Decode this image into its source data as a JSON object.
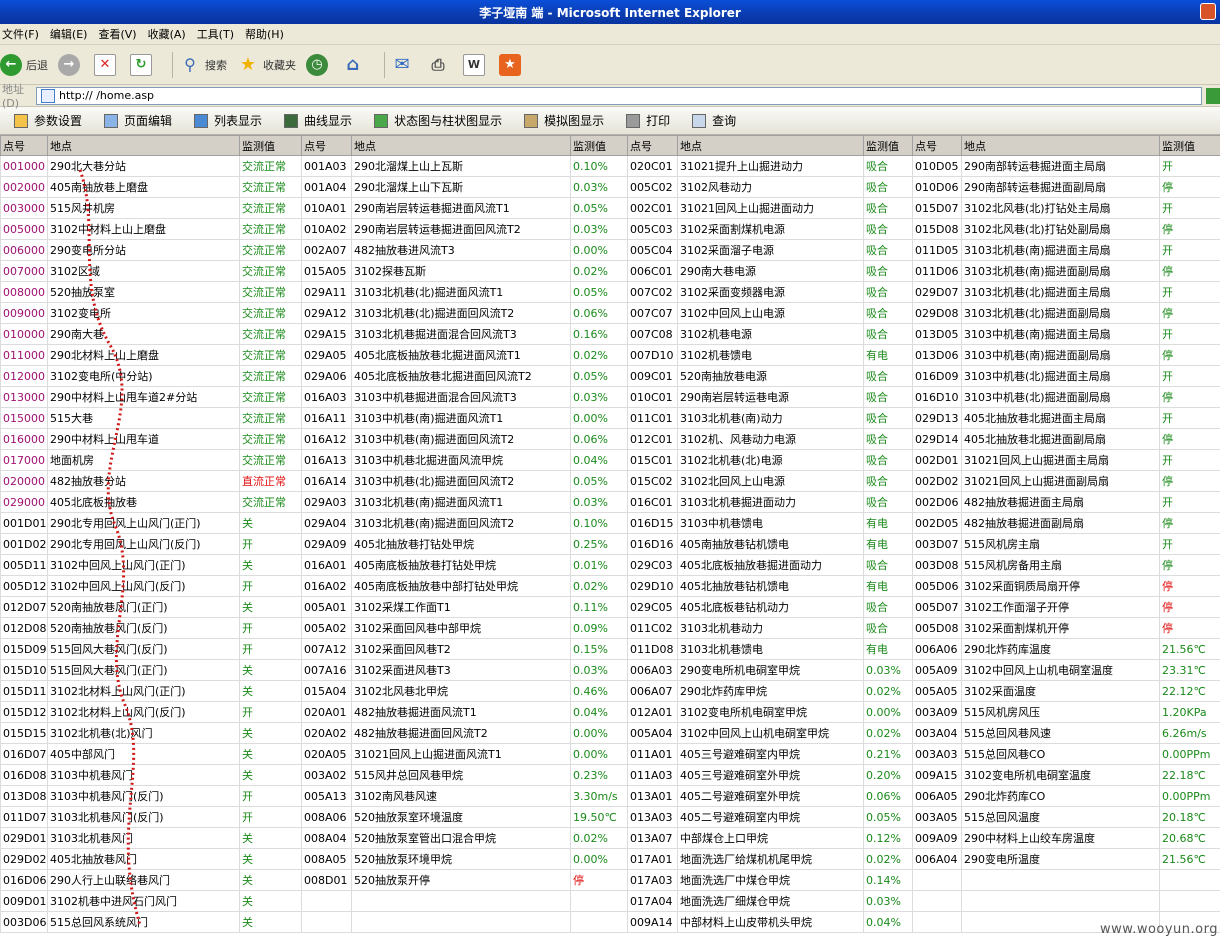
{
  "window": {
    "title": "李子垭南           端 - Microsoft Internet Explorer"
  },
  "menu": [
    "文件(F)",
    "编辑(E)",
    "查看(V)",
    "收藏(A)",
    "工具(T)",
    "帮助(H)"
  ],
  "toolbar": {
    "back": "后退",
    "search": "搜索",
    "favorites": "收藏夹"
  },
  "address": {
    "label": "地址(D)",
    "url": "http://                        /home.asp"
  },
  "appnav": [
    "参数设置",
    "页面编辑",
    "列表显示",
    "曲线显示",
    "状态图与柱状图显示",
    "模拟图显示",
    "打印",
    "查询"
  ],
  "headers": [
    "点号",
    "地点",
    "监测值",
    "点号",
    "地点",
    "监测值",
    "点号",
    "地点",
    "监测值",
    "点号",
    "地点",
    "监测值"
  ],
  "rows": [
    [
      "001000",
      "290北大巷分站",
      "交流正常",
      "001A03",
      "290北溜煤上山上瓦斯",
      "0.10%",
      "020C01",
      "31021提升上山掘进动力",
      "吸合",
      "010D05",
      "290南部转运巷掘进面主局扇",
      "开"
    ],
    [
      "002000",
      "405南抽放巷上磨盘",
      "交流正常",
      "001A04",
      "290北溜煤上山下瓦斯",
      "0.03%",
      "005C02",
      "3102风巷动力",
      "吸合",
      "010D06",
      "290南部转运巷掘进面副局扇",
      "停"
    ],
    [
      "003000",
      "515风井机房",
      "交流正常",
      "010A01",
      "290南岩层转运巷掘进面风流T1",
      "0.05%",
      "002C01",
      "31021回风上山掘进面动力",
      "吸合",
      "015D07",
      "3102北风巷(北)打钻处主局扇",
      "开"
    ],
    [
      "005000",
      "3102中材料上山上磨盘",
      "交流正常",
      "010A02",
      "290南岩层转运巷掘进面回风流T2",
      "0.03%",
      "005C03",
      "3102采面割煤机电源",
      "吸合",
      "015D08",
      "3102北风巷(北)打钻处副局扇",
      "停"
    ],
    [
      "006000",
      "290变电所分站",
      "交流正常",
      "002A07",
      "482抽放巷进风流T3",
      "0.00%",
      "005C04",
      "3102采面溜子电源",
      "吸合",
      "011D05",
      "3103北机巷(南)掘进面主局扇",
      "开"
    ],
    [
      "007000",
      "3102区域",
      "交流正常",
      "015A05",
      "3102探巷瓦斯",
      "0.02%",
      "006C01",
      "290南大巷电源",
      "吸合",
      "011D06",
      "3103北机巷(南)掘进面副局扇",
      "停"
    ],
    [
      "008000",
      "520抽放泵室",
      "交流正常",
      "029A11",
      "3103北机巷(北)掘进面风流T1",
      "0.05%",
      "007C02",
      "3102采面变频器电源",
      "吸合",
      "029D07",
      "3103北机巷(北)掘进面主局扇",
      "开"
    ],
    [
      "009000",
      "3102变电所",
      "交流正常",
      "029A12",
      "3103北机巷(北)掘进面回风流T2",
      "0.06%",
      "007C07",
      "3102中回风上山电源",
      "吸合",
      "029D08",
      "3103北机巷(北)掘进面副局扇",
      "停"
    ],
    [
      "010000",
      "290南大巷",
      "交流正常",
      "029A15",
      "3103北机巷掘进面混合回风流T3",
      "0.16%",
      "007C08",
      "3102机巷电源",
      "吸合",
      "013D05",
      "3103中机巷(南)掘进面主局扇",
      "开"
    ],
    [
      "011000",
      "290北材料上山上磨盘",
      "交流正常",
      "029A05",
      "405北底板抽放巷北掘进面风流T1",
      "0.02%",
      "007D10",
      "3102机巷馈电",
      "有电",
      "013D06",
      "3103中机巷(南)掘进面副局扇",
      "停"
    ],
    [
      "012000",
      "3102变电所(中分站)",
      "交流正常",
      "029A06",
      "405北底板抽放巷北掘进面回风流T2",
      "0.05%",
      "009C01",
      "520南抽放巷电源",
      "吸合",
      "016D09",
      "3103中机巷(北)掘进面主局扇",
      "开"
    ],
    [
      "013000",
      "290中材料上山甩车道2#分站",
      "交流正常",
      "016A03",
      "3103中机巷掘进面混合回风流T3",
      "0.03%",
      "010C01",
      "290南岩层转运巷电源",
      "吸合",
      "016D10",
      "3103中机巷(北)掘进面副局扇",
      "停"
    ],
    [
      "015000",
      "515大巷",
      "交流正常",
      "016A11",
      "3103中机巷(南)掘进面风流T1",
      "0.00%",
      "011C01",
      "3103北机巷(南)动力",
      "吸合",
      "029D13",
      "405北抽放巷北掘进面主局扇",
      "开"
    ],
    [
      "016000",
      "290中材料上山甩车道",
      "交流正常",
      "016A12",
      "3103中机巷(南)掘进面回风流T2",
      "0.06%",
      "012C01",
      "3102机、风巷动力电源",
      "吸合",
      "029D14",
      "405北抽放巷北掘进面副局扇",
      "停"
    ],
    [
      "017000",
      "地面机房",
      "交流正常",
      "016A13",
      "3103中机巷北掘进面风流甲烷",
      "0.04%",
      "015C01",
      "3102北机巷(北)电源",
      "吸合",
      "002D01",
      "31021回风上山掘进面主局扇",
      "开"
    ],
    [
      "020000",
      "482抽放巷分站",
      "直流正常",
      "016A14",
      "3103中机巷(北)掘进面回风流T2",
      "0.05%",
      "015C02",
      "3102北回风上山电源",
      "吸合",
      "002D02",
      "31021回风上山掘进面副局扇",
      "停"
    ],
    [
      "029000",
      "405北底板抽放巷",
      "交流正常",
      "029A03",
      "3103北机巷(南)掘进面风流T1",
      "0.03%",
      "016C01",
      "3103北机巷掘进面动力",
      "吸合",
      "002D06",
      "482抽放巷掘进面主局扇",
      "开"
    ],
    [
      "001D01",
      "290北专用回风上山风门(正门)",
      "关",
      "029A04",
      "3103北机巷(南)掘进面回风流T2",
      "0.10%",
      "016D15",
      "3103中机巷馈电",
      "有电",
      "002D05",
      "482抽放巷掘进面副局扇",
      "停"
    ],
    [
      "001D02",
      "290北专用回风上山风门(反门)",
      "开",
      "029A09",
      "405北抽放巷打钻处甲烷",
      "0.25%",
      "016D16",
      "405南抽放巷钻机馈电",
      "有电",
      "003D07",
      "515风机房主扇",
      "开"
    ],
    [
      "005D11",
      "3102中回风上山风门(正门)",
      "关",
      "016A01",
      "405南底板抽放巷打钻处甲烷",
      "0.01%",
      "029C03",
      "405北底板抽放巷掘进面动力",
      "吸合",
      "003D08",
      "515风机房备用主扇",
      "停"
    ],
    [
      "005D12",
      "3102中回风上山风门(反门)",
      "开",
      "016A02",
      "405南底板抽放巷中部打钻处甲烷",
      "0.02%",
      "029D10",
      "405北抽放巷钻机馈电",
      "有电",
      "005D06",
      "3102采面铜质局扇开停",
      "停"
    ],
    [
      "012D07",
      "520南抽放巷风门(正门)",
      "关",
      "005A01",
      "3102采煤工作面T1",
      "0.11%",
      "029C05",
      "405北底板巷钻机动力",
      "吸合",
      "005D07",
      "3102工作面溜子开停",
      "停"
    ],
    [
      "012D08",
      "520南抽放巷风门(反门)",
      "开",
      "005A02",
      "3102采面回风巷中部甲烷",
      "0.09%",
      "011C02",
      "3103北机巷动力",
      "吸合",
      "005D08",
      "3102采面割煤机开停",
      "停"
    ],
    [
      "015D09",
      "515回风大巷风门(反门)",
      "开",
      "007A12",
      "3102采面回风巷T2",
      "0.15%",
      "011D08",
      "3103北机巷馈电",
      "有电",
      "006A06",
      "290北炸药库温度",
      "21.56℃"
    ],
    [
      "015D10",
      "515回风大巷风门(正门)",
      "关",
      "007A16",
      "3102采面进风巷T3",
      "0.03%",
      "006A03",
      "290变电所机电硐室甲烷",
      "0.03%",
      "005A09",
      "3102中回风上山机电硐室温度",
      "23.31℃"
    ],
    [
      "015D11",
      "3102北材料上山风门(正门)",
      "关",
      "015A04",
      "3102北风巷北甲烷",
      "0.46%",
      "006A07",
      "290北炸药库甲烷",
      "0.02%",
      "005A05",
      "3102采面温度",
      "22.12℃"
    ],
    [
      "015D12",
      "3102北材料上山风门(反门)",
      "开",
      "020A01",
      "482抽放巷掘进面风流T1",
      "0.04%",
      "012A01",
      "3102变电所机电硐室甲烷",
      "0.00%",
      "003A09",
      "515风机房风压",
      "1.20KPa"
    ],
    [
      "015D15",
      "3102北机巷(北)风门",
      "关",
      "020A02",
      "482抽放巷掘进面回风流T2",
      "0.00%",
      "005A04",
      "3102中回风上山机电硐室甲烷",
      "0.02%",
      "003A04",
      "515总回风巷风速",
      "6.26m/s"
    ],
    [
      "016D07",
      "405中部风门",
      "关",
      "020A05",
      "31021回风上山掘进面风流T1",
      "0.00%",
      "011A01",
      "405三号避难硐室内甲烷",
      "0.21%",
      "003A03",
      "515总回风巷CO",
      "0.00PPm"
    ],
    [
      "016D08",
      "3103中机巷风门",
      "关",
      "003A02",
      "515风井总回风巷甲烷",
      "0.23%",
      "011A03",
      "405三号避难硐室外甲烷",
      "0.20%",
      "009A15",
      "3102变电所机电硐室温度",
      "22.18℃"
    ],
    [
      "013D08",
      "3103中机巷风门(反门)",
      "开",
      "005A13",
      "3102南风巷风速",
      "3.30m/s",
      "013A01",
      "405二号避难硐室外甲烷",
      "0.06%",
      "006A05",
      "290北炸药库CO",
      "0.00PPm"
    ],
    [
      "011D07",
      "3103北机巷风门(反门)",
      "开",
      "008A06",
      "520抽放泵室环境温度",
      "19.50℃",
      "013A03",
      "405二号避难硐室内甲烷",
      "0.05%",
      "003A05",
      "515总回风温度",
      "20.18℃"
    ],
    [
      "029D01",
      "3103北机巷风门",
      "关",
      "008A04",
      "520抽放泵室管出口混合甲烷",
      "0.02%",
      "013A07",
      "中部煤仓上口甲烷",
      "0.12%",
      "009A09",
      "290中材料上山绞车房温度",
      "20.68℃"
    ],
    [
      "029D02",
      "405北抽放巷风门",
      "关",
      "008A05",
      "520抽放泵环境甲烷",
      "0.00%",
      "017A01",
      "地面洗选厂给煤机机尾甲烷",
      "0.02%",
      "006A04",
      "290变电所温度",
      "21.56℃"
    ],
    [
      "016D06",
      "290人行上山联络巷风门",
      "关",
      "008D01",
      "520抽放泵开停",
      "停",
      "017A03",
      "地面洗选厂中煤仓甲烷",
      "0.14%",
      "",
      "",
      ""
    ],
    [
      "009D01",
      "3102机巷中进风石门风门",
      "关",
      "",
      "",
      "",
      "017A04",
      "地面洗选厂细煤仓甲烷",
      "0.03%",
      "",
      "",
      ""
    ],
    [
      "003D06",
      "515总回风系统风门",
      "关",
      "",
      "",
      "",
      "009A14",
      "中部材料上山皮带机头甲烷",
      "0.04%",
      "",
      "",
      ""
    ]
  ],
  "watermark": "www.wooyun.org",
  "colors": {
    "normal_value": "#1a8a1a",
    "alert_value": "#e01010",
    "station_id": "#a01070"
  }
}
